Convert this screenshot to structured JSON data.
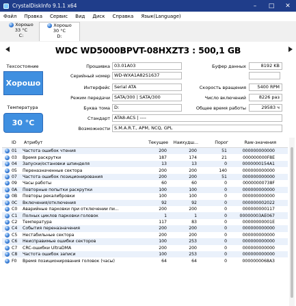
{
  "window": {
    "title": "CrystalDiskInfo 9.1.1 x64"
  },
  "menu": [
    "Файл",
    "Правка",
    "Сервис",
    "Вид",
    "Диск",
    "Справка",
    "Язык(Language)"
  ],
  "drives": [
    {
      "status": "Хорошо",
      "temp": "33 °C",
      "letter": "C:"
    },
    {
      "status": "Хорошо",
      "temp": "30 °C",
      "letter": "D:"
    }
  ],
  "disk": {
    "title": "WDC WD5000BPVT-08HXZT3 : 500,1 GB",
    "tech_state_label": "Техсостояние",
    "status": "Хорошо",
    "temp_label": "Температура",
    "temp": "30 °C",
    "firmware_label": "Прошивка",
    "firmware": "03.01A03",
    "serial_label": "Серийный номер",
    "serial": "WD-WXA1A82S1637",
    "interface_label": "Интерфейс",
    "interface": "Serial ATA",
    "transfer_label": "Режим передачи",
    "transfer": "SATA/300 | SATA/300",
    "volume_label": "Буква тома",
    "volume": "D:",
    "standard_label": "Стандарт",
    "standard": "ATA8-ACS | ----",
    "features_label": "Возможности",
    "features": "S.M.A.R.T., APM, NCQ, GPL",
    "buffer_label": "Буфер данных",
    "buffer": "8192 KB",
    "rpm_label": "Скорость вращения",
    "rpm": "5400 RPM",
    "poweron_count_label": "Число включений",
    "poweron_count": "8226 раз",
    "poweron_hours_label": "Общее время работы",
    "poweron_hours": "29583 ч"
  },
  "table": {
    "headers": [
      "ID",
      "Атрибут",
      "Текущее",
      "Наихудш...",
      "Порог",
      "Raw-значения"
    ],
    "rows": [
      [
        "01",
        "Частота ошибок чтения",
        "200",
        "200",
        "51",
        "000000000000"
      ],
      [
        "03",
        "Время раскрутки",
        "187",
        "174",
        "21",
        "000000000F8E"
      ],
      [
        "04",
        "Запуски/остановки шпинделя",
        "13",
        "13",
        "0",
        "0000000154A1"
      ],
      [
        "05",
        "Переназначенные сектора",
        "200",
        "200",
        "140",
        "000000000000"
      ],
      [
        "07",
        "Частота ошибок позиционирования",
        "200",
        "200",
        "51",
        "000000000000"
      ],
      [
        "09",
        "Часы работы",
        "60",
        "60",
        "0",
        "00000000738F"
      ],
      [
        "0A",
        "Повторные попытки раскрутки",
        "100",
        "100",
        "0",
        "000000000000"
      ],
      [
        "0B",
        "Повторы рекалибровки",
        "100",
        "100",
        "0",
        "000000000000"
      ],
      [
        "0C",
        "Включения/отключения",
        "92",
        "92",
        "0",
        "000000002022"
      ],
      [
        "C0",
        "Аварийные парковки при отключении пи...",
        "200",
        "200",
        "0",
        "000000000117"
      ],
      [
        "C1",
        "Полных циклов парковки головок",
        "1",
        "1",
        "0",
        "00000003AE067"
      ],
      [
        "C2",
        "Температура",
        "117",
        "83",
        "0",
        "00000000001E"
      ],
      [
        "C4",
        "События переназначения",
        "200",
        "200",
        "0",
        "000000000000"
      ],
      [
        "C5",
        "Нестабильные сектора",
        "200",
        "200",
        "0",
        "000000000000"
      ],
      [
        "C6",
        "Неисправимые ошибки секторов",
        "100",
        "253",
        "0",
        "000000000000"
      ],
      [
        "C7",
        "CRC-ошибки UltraDMA",
        "200",
        "200",
        "0",
        "000000000000"
      ],
      [
        "C8",
        "Частота ошибок записи",
        "100",
        "253",
        "0",
        "000000000000"
      ],
      [
        "F0",
        "Время позиционирования головок (часы)",
        "64",
        "64",
        "0",
        "0000000068A3"
      ]
    ]
  },
  "colors": {
    "accent": "#3f8fe0",
    "titlebar": "#1f3d8a",
    "row_alt": "#eaf1fb"
  }
}
